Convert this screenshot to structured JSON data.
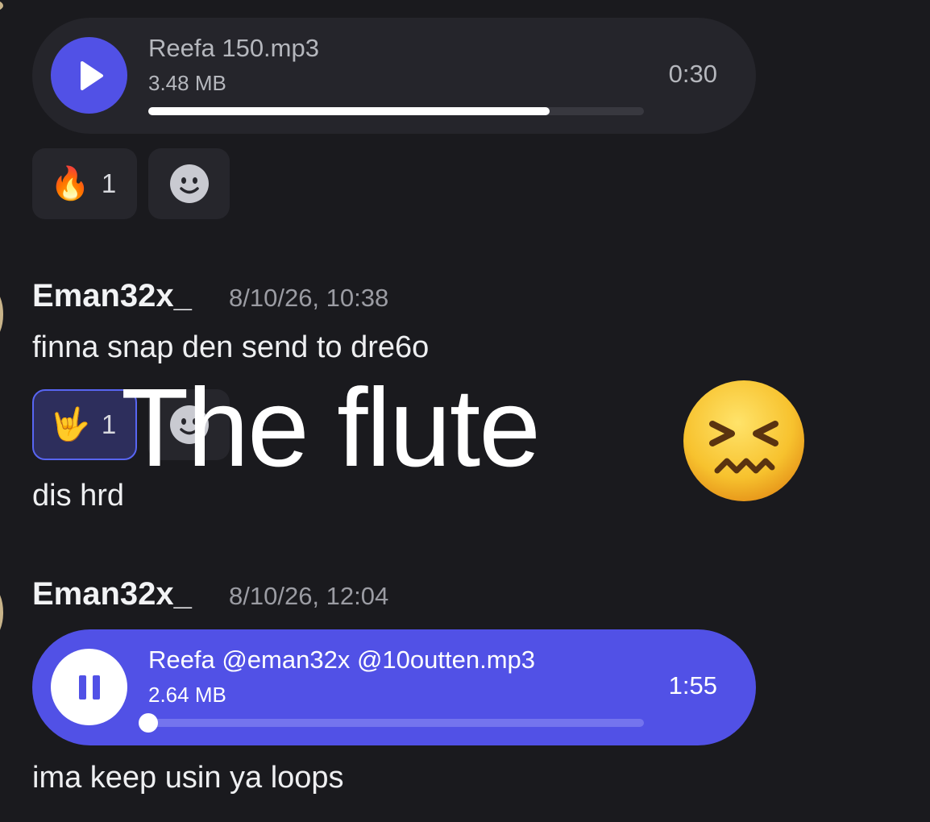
{
  "messages": {
    "audio_1": {
      "file_name": "Reefa 150.mp3",
      "file_size": "3.48 MB",
      "duration": "0:30",
      "progress": 0.81,
      "state": "paused",
      "icon": "play-icon"
    },
    "reactions_1": [
      {
        "emoji": "🔥",
        "count": "1",
        "selected": false
      }
    ],
    "message_2": {
      "username": "Eman32x_",
      "timestamp": "8/10/26, 10:38",
      "text": "finna snap den send to dre6o",
      "reaction": {
        "emoji": "🤟",
        "count": "1",
        "selected": true
      },
      "text_2": "dis hrd"
    },
    "message_3": {
      "username": "Eman32x_",
      "timestamp": "8/10/26, 12:04",
      "audio": {
        "file_name": "Reefa @eman32x @10outten.mp3",
        "file_size": "2.64 MB",
        "duration": "1:55",
        "progress": 0.0,
        "state": "playing",
        "icon": "pause-icon"
      },
      "text": "ima keep usin ya loops"
    }
  },
  "overlay": {
    "text": "The flute",
    "emoji_icon": "confounded-face-icon"
  },
  "colors": {
    "background": "#1a1a1e",
    "accent": "#5151e6",
    "bubble": "#25252b"
  }
}
